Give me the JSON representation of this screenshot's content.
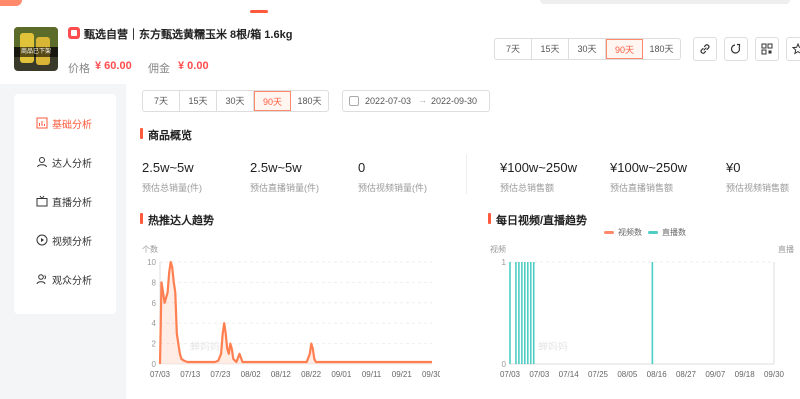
{
  "product": {
    "thumb_overlay": "商品已下架",
    "title": "甄选自营｜东方甄选黄糯玉米 8根/箱 1.6kg",
    "price_label": "价格",
    "price_value": "¥ 60.00",
    "commission_label": "佣金",
    "commission_value": "¥ 0.00"
  },
  "top_ranges": [
    "7天",
    "15天",
    "30天",
    "90天",
    "180天"
  ],
  "top_active_range": "90天",
  "sidebar": {
    "items": [
      {
        "label": "基础分析",
        "icon": "bar-chart-icon",
        "active": true
      },
      {
        "label": "达人分析",
        "icon": "user-icon",
        "active": false
      },
      {
        "label": "直播分析",
        "icon": "tv-icon",
        "active": false
      },
      {
        "label": "视频分析",
        "icon": "play-icon",
        "active": false
      },
      {
        "label": "观众分析",
        "icon": "audience-icon",
        "active": false
      }
    ]
  },
  "main_ranges": [
    "7天",
    "15天",
    "30天",
    "90天",
    "180天"
  ],
  "main_active_range": "90天",
  "date_range": {
    "start": "2022-07-03",
    "arrow": "→",
    "end": "2022-09-30"
  },
  "overview": {
    "title": "商品概览",
    "stats": [
      {
        "value": "2.5w~5w",
        "label": "预估总销量(件)"
      },
      {
        "value": "2.5w~5w",
        "label": "预估直播销量(件)"
      },
      {
        "value": "0",
        "label": "预估视频销量(件)"
      },
      {
        "value": "¥100w~250w",
        "label": "预估总销售额"
      },
      {
        "value": "¥100w~250w",
        "label": "预估直播销售额"
      },
      {
        "value": "¥0",
        "label": "预估视频销售额"
      }
    ]
  },
  "influencer_trend": {
    "title": "热推达人趋势",
    "y_unit": "个数",
    "watermark": "蝉妈妈"
  },
  "daily_trend": {
    "title": "每日视频/直播趋势",
    "legend": [
      {
        "name": "视频数",
        "color": "#ff8a6b"
      },
      {
        "name": "直播数",
        "color": "#4ecdc4"
      }
    ],
    "y_left_unit": "视频",
    "y_right_unit": "直播",
    "watermark": "蝉妈妈"
  },
  "chart_data": [
    {
      "type": "area",
      "title": "热推达人趋势",
      "ylabel": "个数",
      "ylim": [
        0,
        10
      ],
      "yticks": [
        0,
        2,
        4,
        6,
        8,
        10
      ],
      "xticks": [
        "07/03",
        "07/13",
        "07/23",
        "08/02",
        "08/12",
        "08/22",
        "09/01",
        "09/11",
        "09/21",
        "09/30"
      ],
      "series": [
        {
          "color": "#ff7f50",
          "x_days": [
            0,
            0.5,
            1,
            1.5,
            2,
            2.5,
            3,
            3.5,
            4,
            4.5,
            5,
            5.5,
            6,
            6.5,
            7,
            8,
            9,
            10,
            11,
            12,
            13,
            14,
            15,
            16,
            17,
            18,
            19,
            20,
            20.5,
            21,
            21.5,
            22,
            22.5,
            23,
            23.5,
            24,
            25,
            26,
            27,
            28,
            30,
            35,
            40,
            45,
            48,
            49,
            49.5,
            50,
            50.5,
            51,
            52,
            60,
            70,
            80,
            89
          ],
          "values": [
            0,
            8,
            7,
            6,
            6.5,
            7,
            9,
            10,
            9.5,
            8,
            7,
            3,
            2,
            1,
            0.5,
            0.3,
            0.2,
            0.2,
            0.2,
            0.2,
            0.2,
            0.2,
            0.2,
            0.2,
            0.2,
            0.2,
            0.3,
            1,
            3,
            4,
            3,
            1.5,
            1,
            2,
            1.5,
            0.5,
            0.2,
            1,
            0.2,
            0.2,
            0.2,
            0.2,
            0.2,
            0.2,
            0.2,
            1,
            2,
            1.5,
            0.5,
            0.2,
            0.2,
            0.2,
            0.2,
            0.2,
            0.2
          ]
        }
      ]
    },
    {
      "type": "bar",
      "title": "每日视频/直播趋势",
      "ylim": [
        0,
        1
      ],
      "yticks": [
        0,
        1
      ],
      "xticks": [
        "07/03",
        "07/03",
        "07/14",
        "07/25",
        "08/05",
        "08/16",
        "08/27",
        "09/07",
        "09/18",
        "09/30"
      ],
      "series": [
        {
          "name": "视频数",
          "color": "#ff8a6b",
          "days": [],
          "values": []
        },
        {
          "name": "直播数",
          "color": "#4ecdc4",
          "days": [
            0,
            2,
            3,
            4,
            5,
            6,
            7,
            8,
            48
          ],
          "values": [
            1,
            1,
            1,
            1,
            1,
            1,
            1,
            1,
            1
          ]
        }
      ]
    }
  ]
}
